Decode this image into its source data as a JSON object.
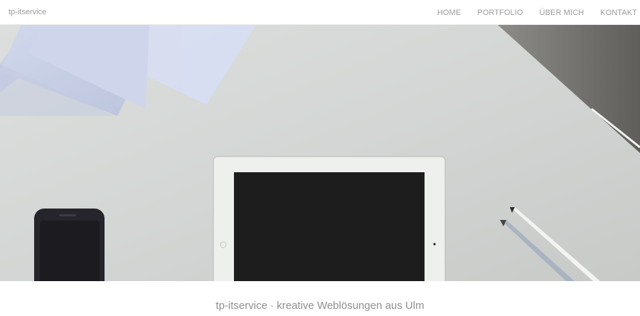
{
  "nav": {
    "brand": "tp-itservice",
    "links": [
      {
        "label": "HOME"
      },
      {
        "label": "PORTFOLIO"
      },
      {
        "label": "ÜBER MICH"
      },
      {
        "label": "KONTAKT"
      }
    ]
  },
  "hero": {
    "image": "desk-with-tablet-phone-pencils-photo"
  },
  "footer": {
    "tagline": "tp-itservice · kreative Weblösungen aus Ulm"
  }
}
